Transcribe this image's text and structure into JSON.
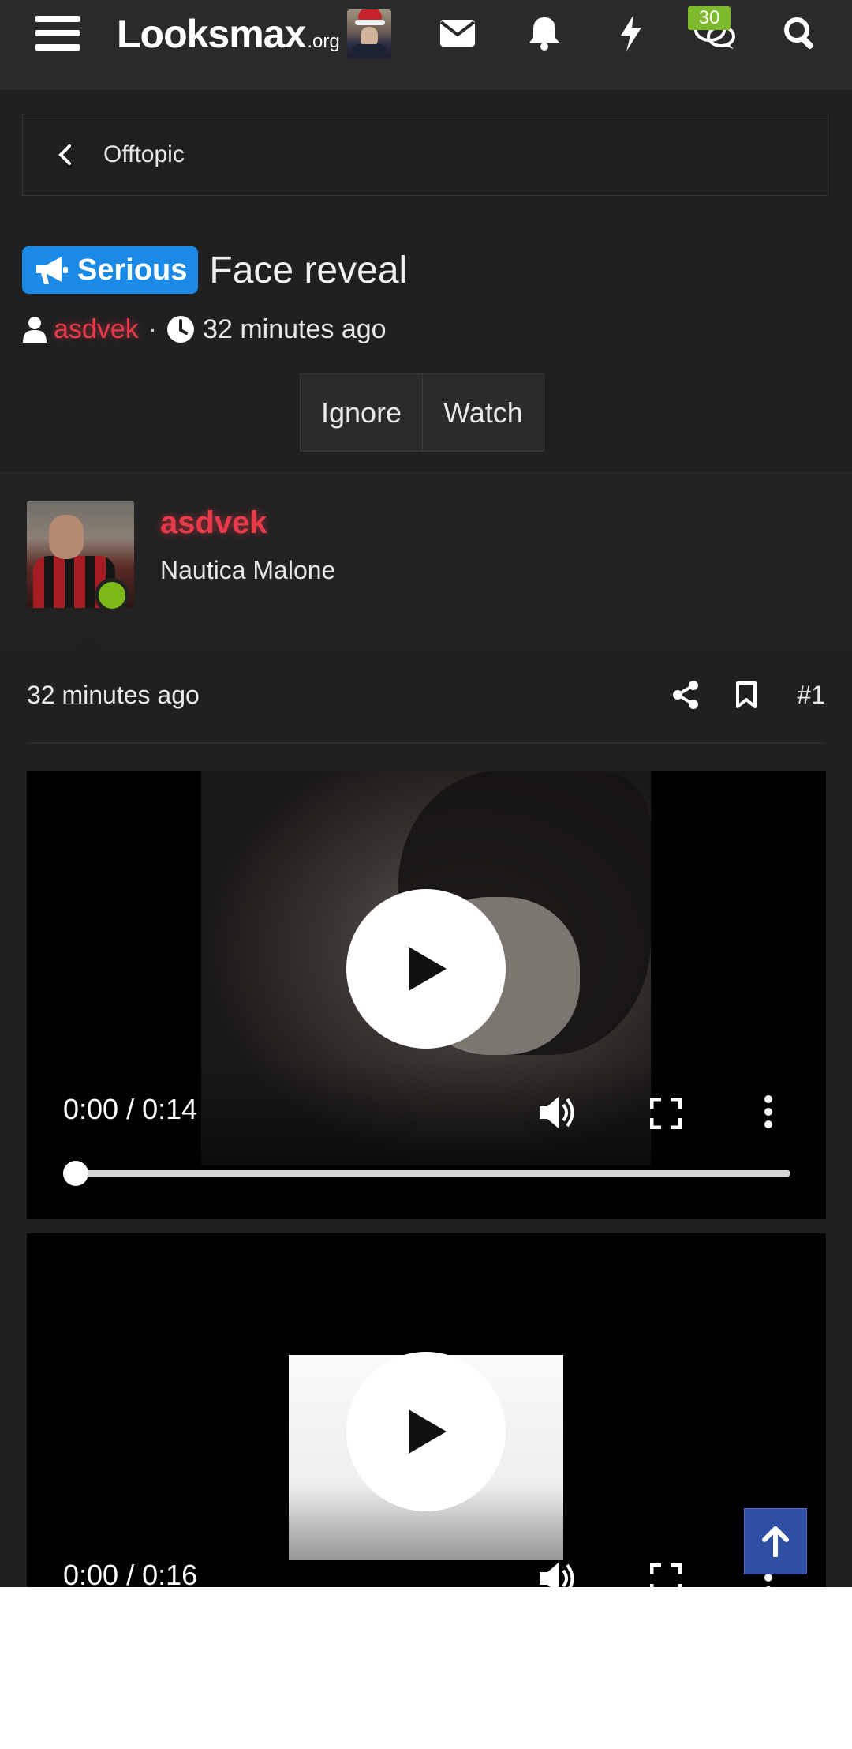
{
  "header": {
    "logo_main": "Looksmax",
    "logo_suffix": ".org",
    "notification_count": "30"
  },
  "breadcrumb": {
    "label": "Offtopic"
  },
  "thread": {
    "prefix": "Serious",
    "title": "Face reveal",
    "author": "asdvek",
    "separator": "·",
    "time": "32 minutes ago",
    "ignore_label": "Ignore",
    "watch_label": "Watch"
  },
  "post": {
    "username": "asdvek",
    "user_title": "Nautica Malone",
    "time": "32 minutes ago",
    "number": "#1"
  },
  "videos": [
    {
      "time": "0:00 / 0:14",
      "progress": 0
    },
    {
      "time": "0:00 / 0:16",
      "progress": 0
    }
  ],
  "colors": {
    "accent": "#1a8ae6",
    "username": "#e83a4a",
    "online": "#7cba1c",
    "badge": "#7cba2c",
    "scroll_top": "#2f4fa2"
  }
}
